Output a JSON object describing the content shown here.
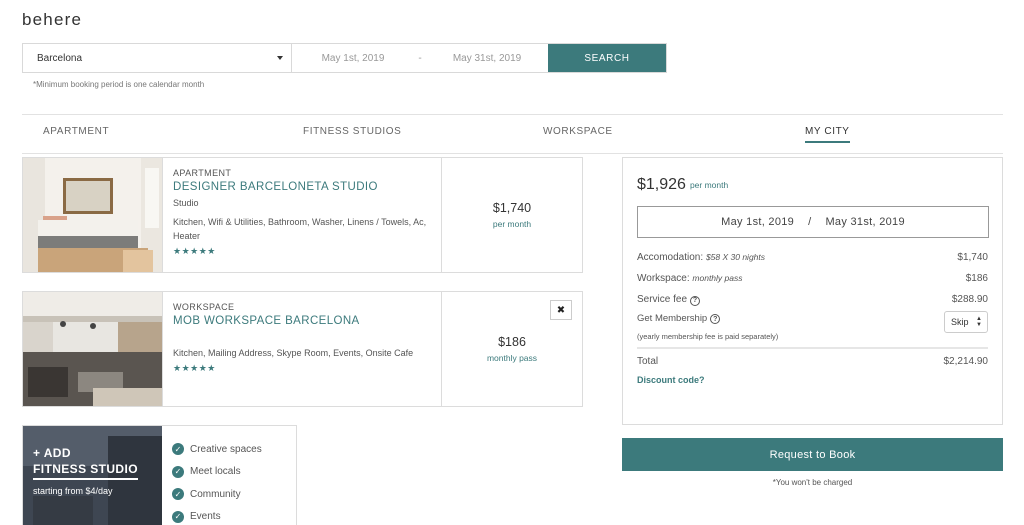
{
  "brand": {
    "logo": "behere"
  },
  "search": {
    "city": "Barcelona",
    "start_date": "May 1st, 2019",
    "date_separator": "-",
    "end_date": "May 31st, 2019",
    "button": "SEARCH",
    "note": "*Minimum booking period is one calendar month"
  },
  "tabs": [
    {
      "label": "APARTMENT",
      "active": false
    },
    {
      "label": "FITNESS STUDIOS",
      "active": false
    },
    {
      "label": "WORKSPACE",
      "active": false
    },
    {
      "label": "MY CITY",
      "active": true
    }
  ],
  "listings": [
    {
      "kind": "APARTMENT",
      "title": "DESIGNER BARCELONETA STUDIO",
      "subtitle": "Studio",
      "amenities": "Kitchen, Wifi & Utilities, Bathroom, Washer, Linens / Towels, Ac, Heater",
      "rating": 5,
      "stars": "★★★★★",
      "price": "$1,740",
      "unit": "per month"
    },
    {
      "kind": "WORKSPACE",
      "title": "MOB WORKSPACE BARCELONA",
      "amenities": "Kitchen, Mailing Address, Skype Room, Events, Onsite Cafe",
      "rating": 5,
      "stars": "★★★★★",
      "price": "$186",
      "unit": "monthly pass",
      "remove": "✖"
    }
  ],
  "fitness_promo": {
    "add": "+ ADD",
    "title": "FITNESS STUDIO",
    "from": "starting from $4/day",
    "benefits": [
      "Creative spaces",
      "Meet locals",
      "Community",
      "Events"
    ]
  },
  "summary": {
    "total_price": "$1,926",
    "per": "per month",
    "start": "May 1st, 2019",
    "sep": "/",
    "end": "May 31st, 2019",
    "accommodation_label": "Accomodation:",
    "accommodation_detail": "$58 X 30 nights",
    "accommodation_value": "$1,740",
    "workspace_label": "Workspace:",
    "workspace_detail": "monthly pass",
    "workspace_value": "$186",
    "service_label": "Service fee",
    "service_value": "$288.90",
    "membership_label": "Get Membership",
    "membership_option": "Skip",
    "membership_note": "(yearly membership fee is paid separately)",
    "total_label": "Total",
    "total_value": "$2,214.90",
    "discount": "Discount code?"
  },
  "book": {
    "button": "Request to Book",
    "note": "*You won't be charged"
  },
  "colors": {
    "accent": "#3c7a7c"
  }
}
